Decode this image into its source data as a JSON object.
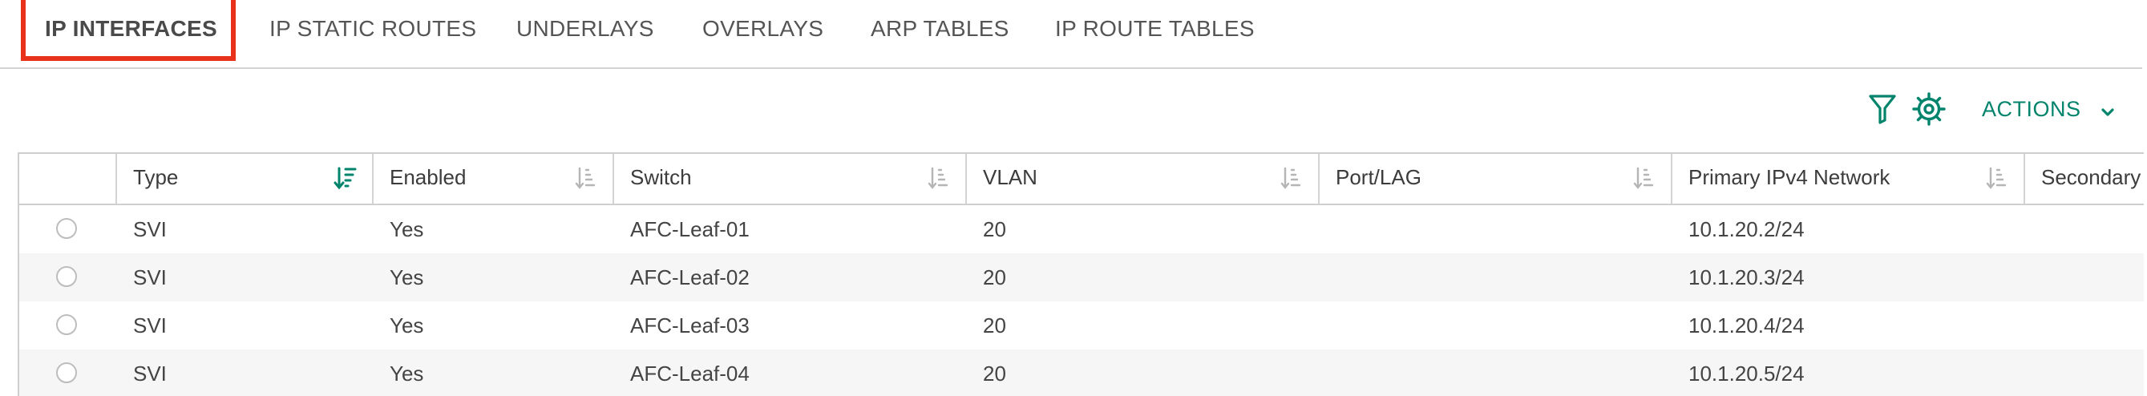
{
  "tabs": [
    {
      "label": "IP INTERFACES",
      "active": true
    },
    {
      "label": "IP STATIC ROUTES",
      "active": false
    },
    {
      "label": "UNDERLAYS",
      "active": false
    },
    {
      "label": "OVERLAYS",
      "active": false
    },
    {
      "label": "ARP TABLES",
      "active": false
    },
    {
      "label": "IP ROUTE TABLES",
      "active": false
    }
  ],
  "toolbar": {
    "filter_icon": "filter-icon",
    "settings_icon": "gear-icon",
    "actions_label": "ACTIONS",
    "actions_icon": "chevron-down-icon"
  },
  "colors": {
    "accent": "#01846b",
    "highlight": "#e8321c",
    "row_alt": "#f6f6f6"
  },
  "table": {
    "columns": [
      {
        "label": "",
        "sortable": false
      },
      {
        "label": "Type",
        "sortable": true,
        "sort_active": true
      },
      {
        "label": "Enabled",
        "sortable": true
      },
      {
        "label": "Switch",
        "sortable": true
      },
      {
        "label": "VLAN",
        "sortable": true
      },
      {
        "label": "Port/LAG",
        "sortable": true
      },
      {
        "label": "Primary IPv4 Network",
        "sortable": true
      },
      {
        "label": "Secondary",
        "sortable": true
      }
    ],
    "rows": [
      {
        "type": "SVI",
        "enabled": "Yes",
        "switch": "AFC-Leaf-01",
        "vlan": "20",
        "port_lag": "",
        "primary_ipv4": "10.1.20.2/24"
      },
      {
        "type": "SVI",
        "enabled": "Yes",
        "switch": "AFC-Leaf-02",
        "vlan": "20",
        "port_lag": "",
        "primary_ipv4": "10.1.20.3/24"
      },
      {
        "type": "SVI",
        "enabled": "Yes",
        "switch": "AFC-Leaf-03",
        "vlan": "20",
        "port_lag": "",
        "primary_ipv4": "10.1.20.4/24"
      },
      {
        "type": "SVI",
        "enabled": "Yes",
        "switch": "AFC-Leaf-04",
        "vlan": "20",
        "port_lag": "",
        "primary_ipv4": "10.1.20.5/24"
      }
    ]
  }
}
